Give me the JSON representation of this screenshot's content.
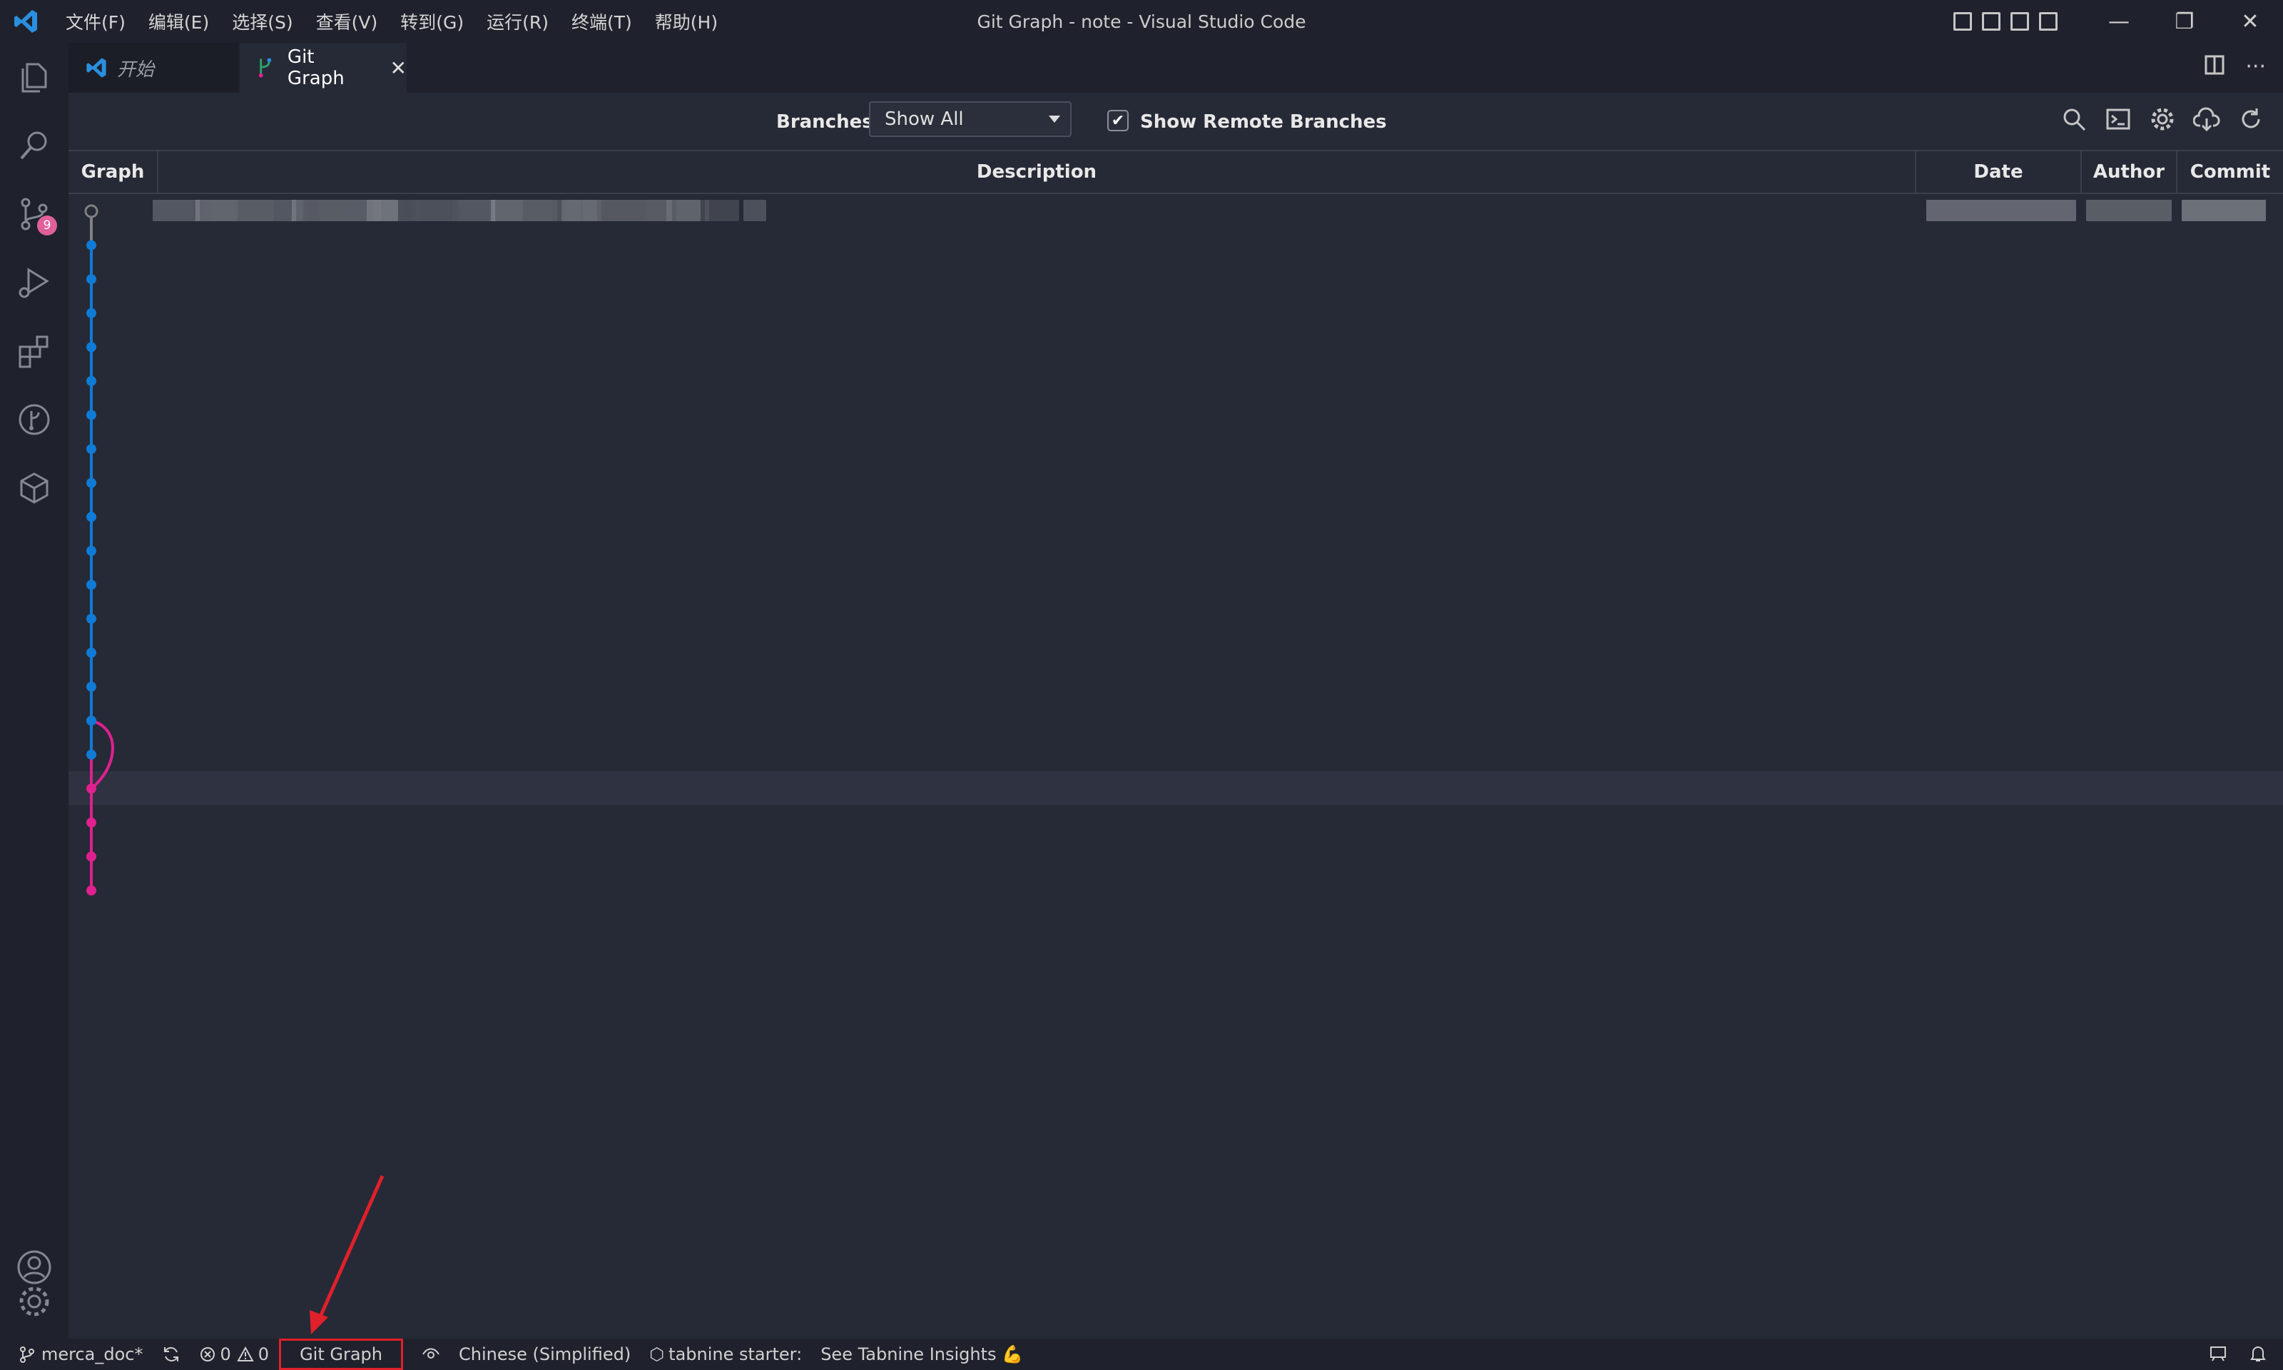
{
  "window": {
    "title": "Git Graph - note - Visual Studio Code",
    "menu": [
      "文件(F)",
      "编辑(E)",
      "选择(S)",
      "查看(V)",
      "转到(G)",
      "运行(R)",
      "终端(T)",
      "帮助(H)"
    ],
    "controls": {
      "minimize": "—",
      "restore": "❐",
      "close": "✕"
    }
  },
  "activity_bar": {
    "items": [
      "explorer-icon",
      "search-icon",
      "source-control-icon",
      "run-debug-icon",
      "extensions-icon",
      "git-graph-icon",
      "remote-explorer-icon"
    ],
    "scm_badge": "9",
    "bottom": [
      "account-icon",
      "settings-gear-icon"
    ]
  },
  "tabs": [
    {
      "label": "开始",
      "icon": "vscode-icon",
      "active": false
    },
    {
      "label": "Git Graph",
      "icon": "git-graph-icon",
      "active": true,
      "close": "✕"
    }
  ],
  "editor_actions": {
    "split": "split-editor-icon",
    "more": "···"
  },
  "controls": {
    "branches_label": "Branches:",
    "branches_value": "Show All",
    "show_remote_label": "Show Remote Branches",
    "show_remote_checked": true,
    "tool_icons": [
      "search-icon",
      "terminal-icon",
      "settings-icon",
      "fetch-icon",
      "refresh-icon"
    ]
  },
  "table": {
    "headers": [
      "Graph",
      "Description",
      "Date",
      "Author",
      "Commit"
    ],
    "row_count": 21,
    "rows_blurred": true
  },
  "graph": {
    "colors": {
      "main": "#0f7bd6",
      "branch": "#e0208f",
      "uncommitted": "#808080"
    }
  },
  "status_bar": {
    "branch": "merca_doc*",
    "errors": "0",
    "warnings": "0",
    "git_graph": "Git Graph",
    "language": "Chinese (Simplified)",
    "tabnine": "tabnine starter:",
    "tabnine_insights": "See Tabnine Insights 💪"
  },
  "colors": {
    "annotation_red": "#e0202a",
    "accent": "#0f7bd6"
  }
}
